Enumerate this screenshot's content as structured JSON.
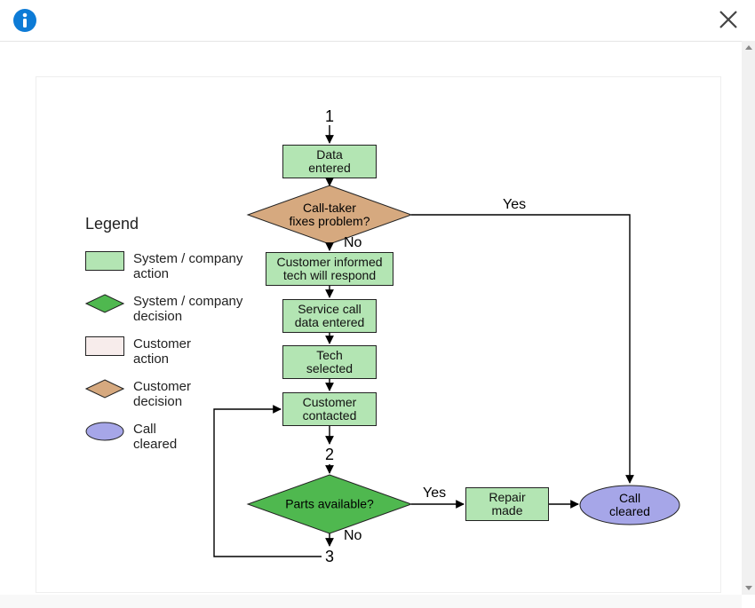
{
  "topbar": {
    "info_icon": "info-icon",
    "close_icon": "close-icon"
  },
  "legend": {
    "title": "Legend",
    "items": [
      {
        "label": "System / company\naction",
        "kind": "rect",
        "fill": "#b3e5b3"
      },
      {
        "label": "System / company\ndecision",
        "kind": "diamond",
        "fill": "#4fb84f"
      },
      {
        "label": "Customer\naction",
        "kind": "rect",
        "fill": "#f7eceb"
      },
      {
        "label": "Customer\ndecision",
        "kind": "diamond",
        "fill": "#d6a97f"
      },
      {
        "label": "Call\ncleared",
        "kind": "ellipse",
        "fill": "#a6a6e8"
      }
    ]
  },
  "flow": {
    "connectors": {
      "c1": "1",
      "c2": "2",
      "c3": "3"
    },
    "nodes": {
      "data_entered": "Data\nentered",
      "call_taker_fixes": "Call-taker\nfixes problem?",
      "customer_informed": "Customer informed\ntech will respond",
      "service_call_data": "Service call\ndata entered",
      "tech_selected": "Tech\nselected",
      "customer_contacted": "Customer\ncontacted",
      "parts_available": "Parts available?",
      "repair_made": "Repair\nmade",
      "call_cleared": "Call\ncleared"
    },
    "edges": {
      "yes1": "Yes",
      "no1": "No",
      "yes2": "Yes",
      "no2": "No"
    }
  },
  "colors": {
    "sys_action": "#b3e5b3",
    "sys_decision": "#4fb84f",
    "cust_decision": "#d6a97f",
    "cleared": "#a6a6e8",
    "stroke": "#222222"
  }
}
